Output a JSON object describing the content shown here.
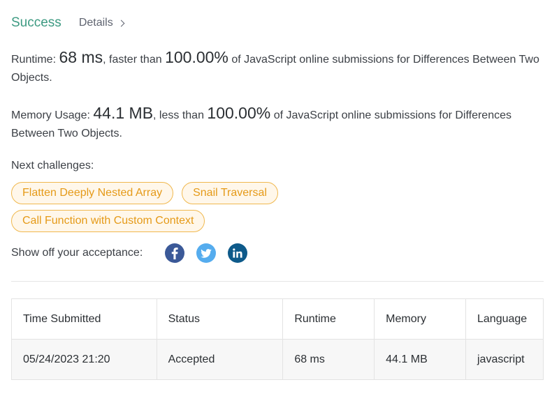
{
  "header": {
    "status": "Success",
    "details_label": "Details"
  },
  "runtime": {
    "label": "Runtime:",
    "value": "68 ms",
    "comparison": ", faster than",
    "percent": "100.00%",
    "suffix": "of JavaScript online submissions for Differences Between Two Objects."
  },
  "memory": {
    "label": "Memory Usage:",
    "value": "44.1 MB",
    "comparison": ", less than",
    "percent": "100.00%",
    "suffix": "of JavaScript online submissions for Differences Between Two Objects."
  },
  "next": {
    "label": "Next challenges:",
    "items": [
      "Flatten Deeply Nested Array",
      "Snail Traversal",
      "Call Function with Custom Context"
    ]
  },
  "share": {
    "label": "Show off your acceptance:",
    "icons": [
      "facebook-icon",
      "twitter-icon",
      "linkedin-icon"
    ]
  },
  "table": {
    "headers": [
      "Time Submitted",
      "Status",
      "Runtime",
      "Memory",
      "Language"
    ],
    "rows": [
      [
        "05/24/2023 21:20",
        "Accepted",
        "68 ms",
        "44.1 MB",
        "javascript"
      ]
    ]
  },
  "colors": {
    "success": "#3d9a82",
    "chip_text": "#e59a18",
    "chip_border": "#f0b84e",
    "facebook": "#3b5998",
    "twitter": "#55acee",
    "linkedin": "#0e5a8a"
  }
}
